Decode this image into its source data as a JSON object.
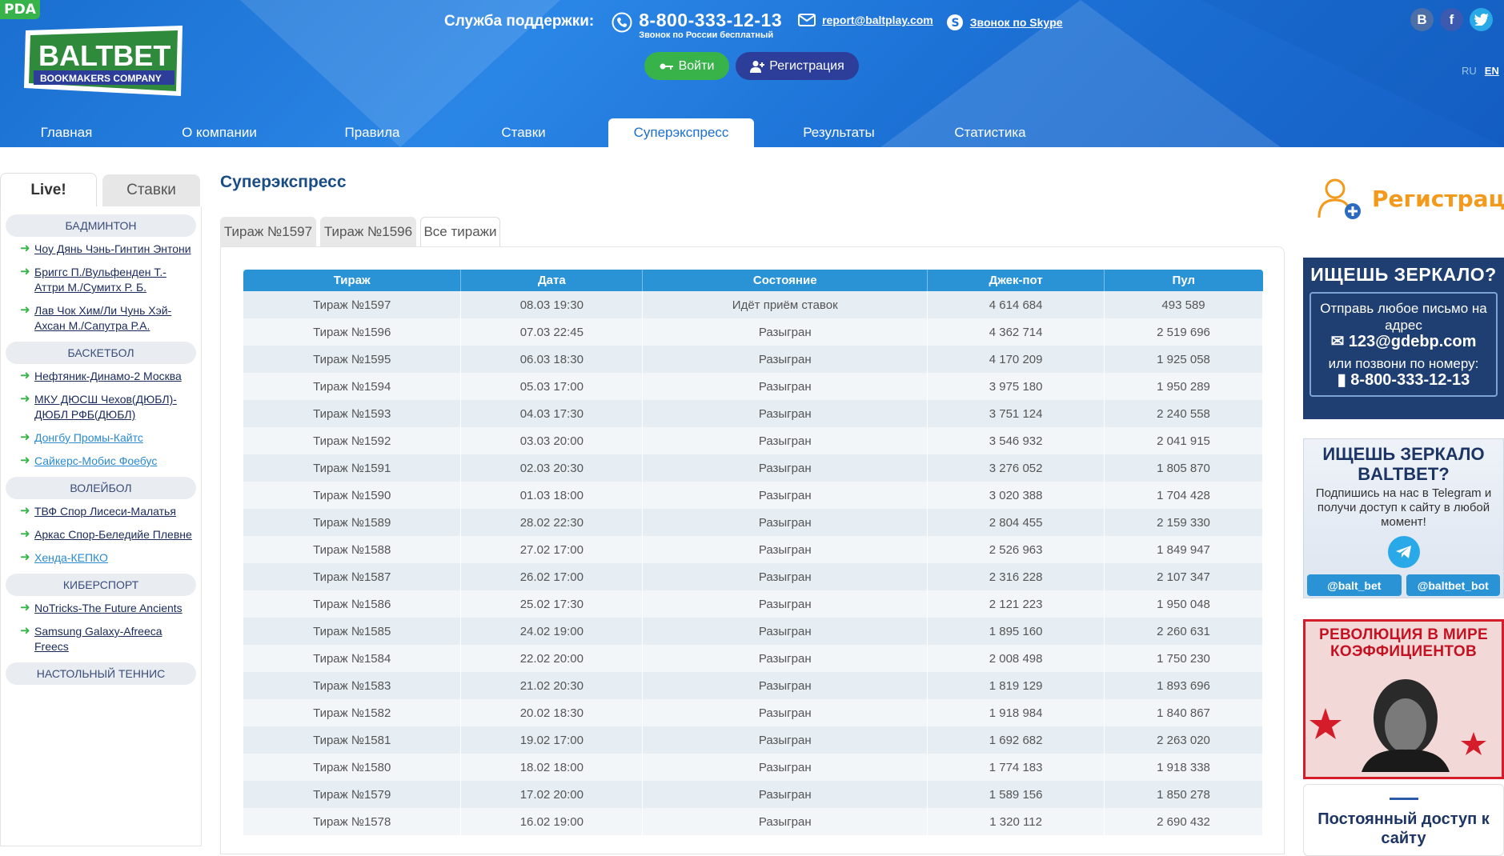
{
  "header": {
    "pda_label": "PDA",
    "logo_text_top": "BALTBET",
    "logo_text_bottom": "BOOKMAKERS COMPANY",
    "support_title": "Служба поддержки:",
    "phone": "8-800-333-12-13",
    "phone_note": "Звонок по России бесплатный",
    "email": "report@baltplay.com",
    "skype": "Звонок по Skype",
    "login_label": "Войти",
    "register_label": "Регистрация",
    "socials": [
      "В",
      "f",
      "t"
    ],
    "lang_ru": "RU",
    "lang_en": "EN"
  },
  "nav": {
    "items": [
      {
        "label": "Главная"
      },
      {
        "label": "О компании"
      },
      {
        "label": "Правила"
      },
      {
        "label": "Ставки"
      },
      {
        "label": "Суперэкспресс",
        "active": true
      },
      {
        "label": "Результаты"
      },
      {
        "label": "Статистика"
      }
    ]
  },
  "sidebar": {
    "tab_live": "Live!",
    "tab_bets": "Ставки",
    "sports": [
      {
        "name": "БАДМИНТОН",
        "events": [
          "Чоу Дянь Чэнь-Гинтин Энтони",
          "Бриггс П./Вульфенден Т.-Аттри М./Сумитх Р. Б.",
          "Лав Чок Хим/Ли Чунь Хэй-Ахсан М./Сапутра Р.А."
        ]
      },
      {
        "name": "БАСКЕТБОЛ",
        "events": [
          "Нефтяник-Динамо-2 Москва",
          "МКУ ДЮСШ Чехов(ДЮБЛ)-ДЮБЛ РФБ(ДЮБЛ)",
          "Донгбу Промы-Кайтс",
          "Сайкерс-Мобис Фоебус"
        ]
      },
      {
        "name": "ВОЛЕЙБОЛ",
        "events": [
          "ТВФ Спор Лисеси-Малатья",
          "Аркас Спор-Беледийе Плевне",
          "Хенда-КЕПКО"
        ]
      },
      {
        "name": "КИБЕРСПОРТ",
        "events": [
          "NoTricks-The Future Ancients",
          "Samsung Galaxy-Afreeca Freecs"
        ]
      },
      {
        "name": "НАСТОЛЬНЫЙ ТЕННИС",
        "events": []
      }
    ]
  },
  "main": {
    "title": "Суперэкспресс",
    "tabs": [
      "Тираж №1597",
      "Тираж №1596",
      "Все тиражи"
    ],
    "table": {
      "headers": [
        "Тираж",
        "Дата",
        "Состояние",
        "Джек-пот",
        "Пул"
      ],
      "rows": [
        [
          "Тираж №1597",
          "08.03 19:30",
          "Идёт приём ставок",
          "4 614 684",
          "493 589"
        ],
        [
          "Тираж №1596",
          "07.03 22:45",
          "Разыгран",
          "4 362 714",
          "2 519 696"
        ],
        [
          "Тираж №1595",
          "06.03 18:30",
          "Разыгран",
          "4 170 209",
          "1 925 058"
        ],
        [
          "Тираж №1594",
          "05.03 17:00",
          "Разыгран",
          "3 975 180",
          "1 950 289"
        ],
        [
          "Тираж №1593",
          "04.03 17:30",
          "Разыгран",
          "3 751 124",
          "2 240 558"
        ],
        [
          "Тираж №1592",
          "03.03 20:00",
          "Разыгран",
          "3 546 932",
          "2 041 915"
        ],
        [
          "Тираж №1591",
          "02.03 20:30",
          "Разыгран",
          "3 276 052",
          "1 805 870"
        ],
        [
          "Тираж №1590",
          "01.03 18:00",
          "Разыгран",
          "3 020 388",
          "1 704 428"
        ],
        [
          "Тираж №1589",
          "28.02 22:30",
          "Разыгран",
          "2 804 455",
          "2 159 330"
        ],
        [
          "Тираж №1588",
          "27.02 17:00",
          "Разыгран",
          "2 526 963",
          "1 849 947"
        ],
        [
          "Тираж №1587",
          "26.02 17:00",
          "Разыгран",
          "2 316 228",
          "2 107 347"
        ],
        [
          "Тираж №1586",
          "25.02 17:30",
          "Разыгран",
          "2 121 223",
          "1 950 048"
        ],
        [
          "Тираж №1585",
          "24.02 19:00",
          "Разыгран",
          "1 895 160",
          "2 260 631"
        ],
        [
          "Тираж №1584",
          "22.02 20:00",
          "Разыгран",
          "2 008 498",
          "1 750 230"
        ],
        [
          "Тираж №1583",
          "21.02 20:30",
          "Разыгран",
          "1 819 129",
          "1 893 696"
        ],
        [
          "Тираж №1582",
          "20.02 18:30",
          "Разыгран",
          "1 918 984",
          "1 840 867"
        ],
        [
          "Тираж №1581",
          "19.02 17:00",
          "Разыгран",
          "1 692 682",
          "2 263 020"
        ],
        [
          "Тираж №1580",
          "18.02 18:00",
          "Разыгран",
          "1 774 183",
          "1 918 338"
        ],
        [
          "Тираж №1579",
          "17.02 20:00",
          "Разыгран",
          "1 589 156",
          "1 850 278"
        ],
        [
          "Тираж №1578",
          "16.02 19:00",
          "Разыгран",
          "1 320 112",
          "2 690 432"
        ]
      ]
    }
  },
  "right": {
    "register_label": "Регистрация",
    "mirror_banner": {
      "title": "ИЩЕШЬ ЗЕРКАЛО?",
      "line1": "Отправь любое письмо на адрес",
      "email": "123@gdebp.com",
      "line2": "или позвони по номеру:",
      "phone": "8-800-333-12-13"
    },
    "telegram_banner": {
      "title": "ИЩЕШЬ ЗЕРКАЛО BALTBET?",
      "text": "Подпишись на нас в Telegram и получи доступ к сайту в любой момент!",
      "btn1": "@balt_bet",
      "btn2": "@baltbet_bot"
    },
    "odds_banner": {
      "title": "РЕВОЛЮЦИЯ В МИРЕ КОЭФФИЦИЕНТОВ"
    },
    "access_banner": {
      "title": "Постоянный доступ к сайту"
    }
  },
  "colors": {
    "header_blue": "#1d72d6",
    "accent_green": "#37b34a",
    "accent_navy": "#2c3e9a",
    "table_header": "#2a93d5",
    "register_orange": "#f39a1c"
  }
}
